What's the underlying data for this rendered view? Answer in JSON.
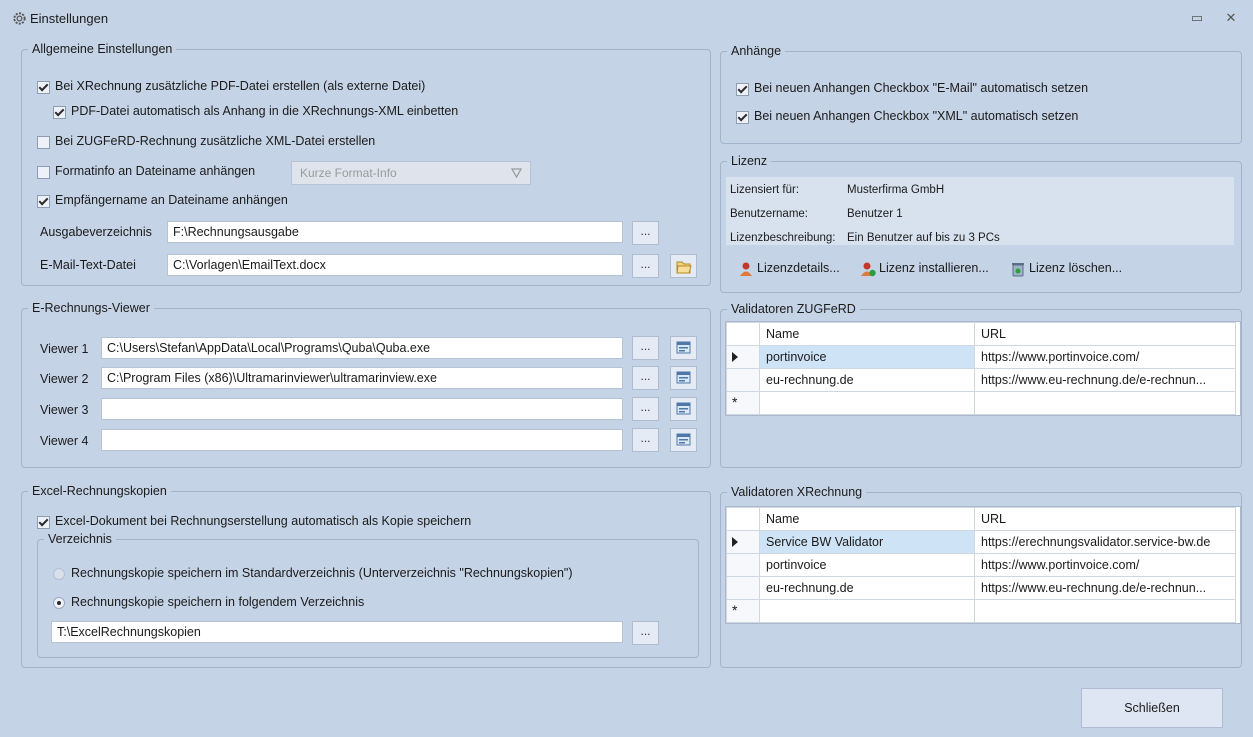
{
  "window": {
    "title": "Einstellungen",
    "minimize_glyph": "▭",
    "close_glyph": "✕"
  },
  "general": {
    "legend": "Allgemeine Einstellungen",
    "opt_pdf": {
      "label": "Bei XRechnung zusätzliche PDF-Datei erstellen (als externe Datei)",
      "checked": true
    },
    "opt_embed": {
      "label": "PDF-Datei automatisch als Anhang in die XRechnungs-XML einbetten",
      "checked": true
    },
    "opt_zugferd_xml": {
      "label": "Bei ZUGFeRD-Rechnung zusätzliche XML-Datei erstellen",
      "checked": false
    },
    "opt_formatinfo": {
      "label": "Formatinfo an Dateiname anhängen",
      "checked": false
    },
    "format_combo": "Kurze Format-Info",
    "opt_recipient": {
      "label": "Empfängername an Dateiname anhängen",
      "checked": true
    },
    "output_dir_label": "Ausgabeverzeichnis",
    "output_dir_value": "F:\\Rechnungsausgabe",
    "email_file_label": "E-Mail-Text-Datei",
    "email_file_value": "C:\\Vorlagen\\EmailText.docx",
    "browse": "..."
  },
  "viewer": {
    "legend": "E-Rechnungs-Viewer",
    "rows": [
      {
        "label": "Viewer 1",
        "value": "C:\\Users\\Stefan\\AppData\\Local\\Programs\\Quba\\Quba.exe"
      },
      {
        "label": "Viewer 2",
        "value": "C:\\Program Files (x86)\\Ultramarinviewer\\ultramarinview.exe"
      },
      {
        "label": "Viewer 3",
        "value": ""
      },
      {
        "label": "Viewer 4",
        "value": ""
      }
    ]
  },
  "excel": {
    "legend": "Excel-Rechnungskopien",
    "opt_save_copy": {
      "label": "Excel-Dokument bei Rechnungserstellung automatisch als Kopie speichern",
      "checked": true
    },
    "dir_legend": "Verzeichnis",
    "radio_standard": "Rechnungskopie speichern im Standardverzeichnis (Unterverzeichnis \"Rechnungskopien\")",
    "radio_custom": "Rechnungskopie speichern in folgendem Verzeichnis",
    "dir_value": "T:\\ExcelRechnungskopien"
  },
  "attachments": {
    "legend": "Anhänge",
    "opt_email": {
      "label": "Bei neuen Anhangen Checkbox \"E-Mail\" automatisch setzen",
      "checked": true
    },
    "opt_xml": {
      "label": "Bei neuen Anhangen Checkbox \"XML\" automatisch setzen",
      "checked": true
    }
  },
  "license": {
    "legend": "Lizenz",
    "licensed_for_label": "Lizensiert für:",
    "licensed_for_value": "Musterfirma GmbH",
    "username_label": "Benutzername:",
    "username_value": "Benutzer 1",
    "description_label": "Lizenzbeschreibung:",
    "description_value": "Ein Benutzer auf bis zu 3 PCs",
    "details_btn": "Lizenzdetails...",
    "install_btn": "Lizenz installieren...",
    "delete_btn": "Lizenz löschen..."
  },
  "zugferd_validators": {
    "legend": "Validatoren ZUGFeRD",
    "headers": [
      "Name",
      "URL"
    ],
    "rows": [
      {
        "name": "portinvoice",
        "url": "https://www.portinvoice.com/"
      },
      {
        "name": "eu-rechnung.de",
        "url": "https://www.eu-rechnung.de/e-rechnun..."
      }
    ]
  },
  "xrechnung_validators": {
    "legend": "Validatoren XRechnung",
    "headers": [
      "Name",
      "URL"
    ],
    "rows": [
      {
        "name": "Service BW Validator",
        "url": "https://erechnungsvalidator.service-bw.de"
      },
      {
        "name": "portinvoice",
        "url": "https://www.portinvoice.com/"
      },
      {
        "name": "eu-rechnung.de",
        "url": "https://www.eu-rechnung.de/e-rechnun..."
      }
    ]
  },
  "new_row_marker": "*",
  "close_button": "Schließen"
}
